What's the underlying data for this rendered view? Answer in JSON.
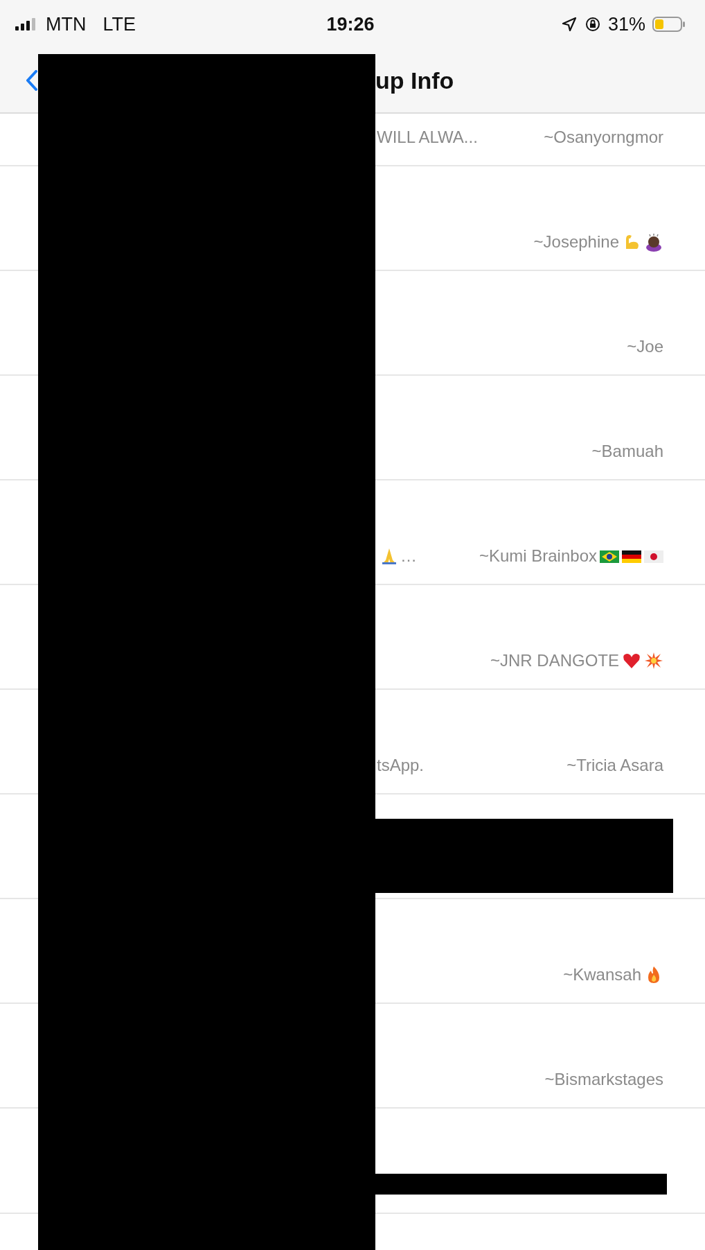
{
  "status_bar": {
    "carrier": "MTN",
    "network": "LTE",
    "time": "19:26",
    "battery": "31%"
  },
  "nav": {
    "title": "up Info"
  },
  "participants": [
    {
      "left": "WILL ALWA...",
      "name": "~Osanyorngmor"
    },
    {
      "name": "~Josephine"
    },
    {
      "name": "~Joe"
    },
    {
      "name": "~Bamuah"
    },
    {
      "left": "…",
      "name": "~Kumi Brainbox"
    },
    {
      "name": "~JNR DANGOTE"
    },
    {
      "left": "tsApp.",
      "name": "~Tricia Asara"
    },
    {
      "redacted": true,
      "thin": false
    },
    {
      "name": "~Kwansah"
    },
    {
      "name": "~Bismarkstages"
    },
    {
      "redacted": true,
      "thin": true
    }
  ]
}
